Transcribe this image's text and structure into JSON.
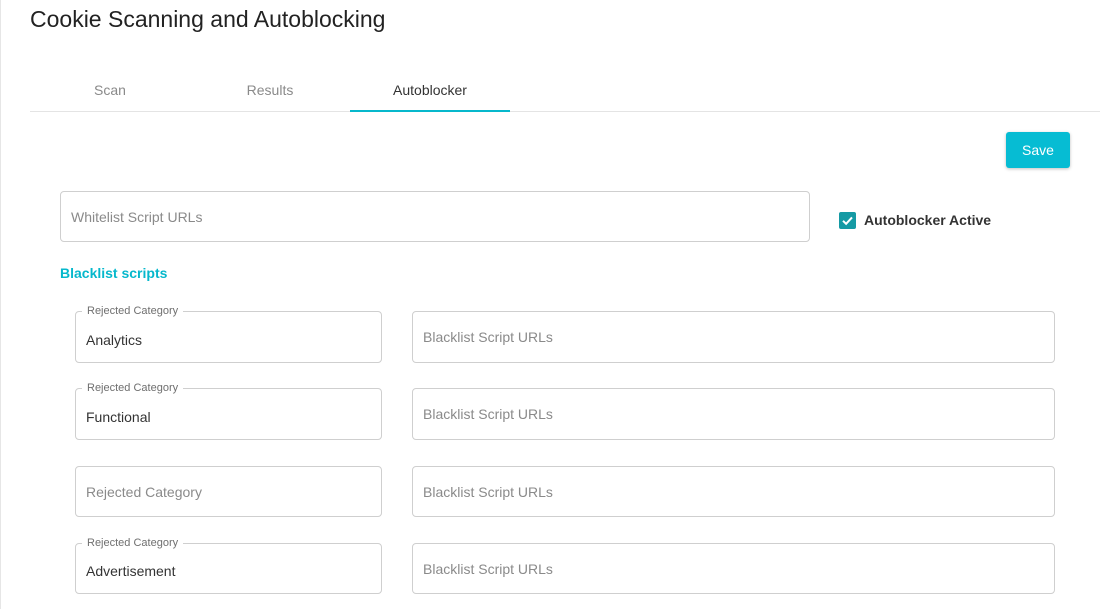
{
  "page": {
    "title": "Cookie Scanning and Autoblocking"
  },
  "tabs": [
    {
      "label": "Scan",
      "active": false
    },
    {
      "label": "Results",
      "active": false
    },
    {
      "label": "Autoblocker",
      "active": true
    }
  ],
  "toolbar": {
    "save_label": "Save"
  },
  "whitelist": {
    "placeholder": "Whitelist Script URLs",
    "value": ""
  },
  "autoblocker": {
    "label": "Autoblocker Active",
    "checked": true
  },
  "blacklist": {
    "heading": "Blacklist scripts",
    "rows": [
      {
        "category_label": "Rejected Category",
        "category_value": "Analytics",
        "url_placeholder": "Blacklist Script URLs"
      },
      {
        "category_label": "Rejected Category",
        "category_value": "Functional",
        "url_placeholder": "Blacklist Script URLs"
      },
      {
        "category_label": "Rejected Category",
        "category_value": "",
        "url_placeholder": "Blacklist Script URLs"
      },
      {
        "category_label": "Rejected Category",
        "category_value": "Advertisement",
        "url_placeholder": "Blacklist Script URLs"
      }
    ]
  },
  "colors": {
    "accent": "#06bcd3",
    "checkbox": "#159aa4",
    "heading": "#06b8cc"
  },
  "icons": {
    "checkbox": "check-icon"
  }
}
